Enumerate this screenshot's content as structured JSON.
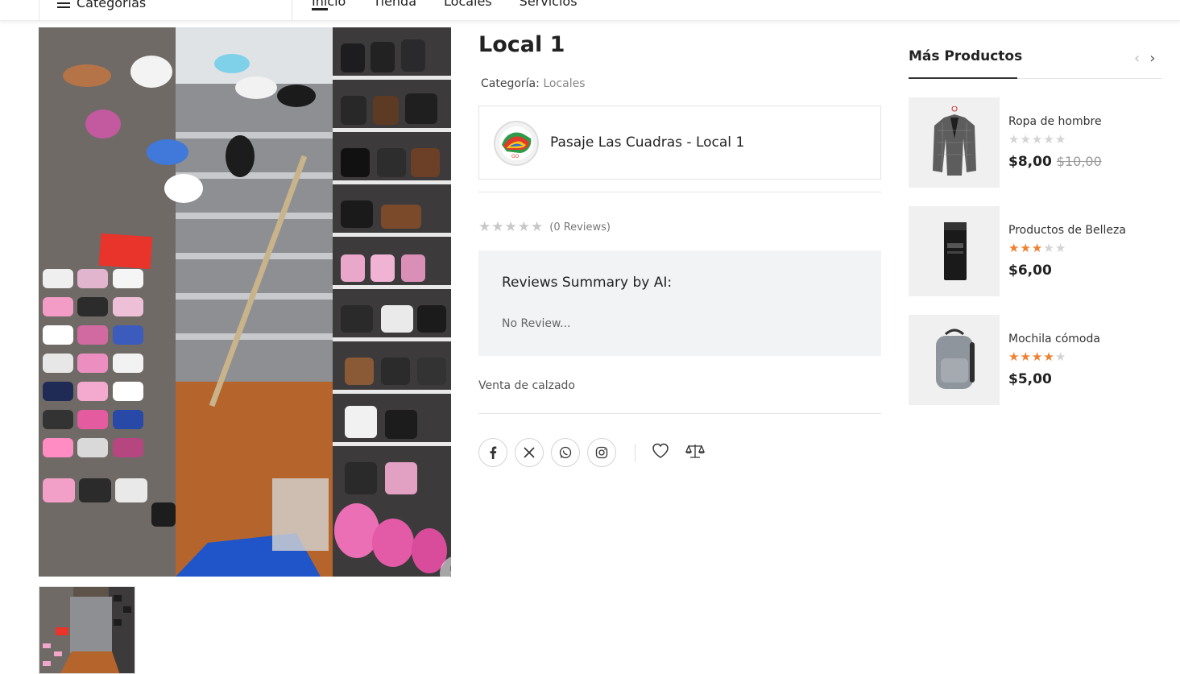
{
  "nav": {
    "categories_label": "Categorías",
    "links": [
      "Inicio",
      "Tienda",
      "Locales",
      "Servicios"
    ]
  },
  "product": {
    "title": "Local 1",
    "category_prefix": "Categoría:",
    "category_link": "Locales",
    "store_name": "Pasaje Las Cuadras - Local 1",
    "reviews_count_text": "(0 Reviews)",
    "rating": 0,
    "ai_summary_title": "Reviews Summary by AI:",
    "ai_summary_text": "No Review...",
    "description": "Venta de calzado"
  },
  "share": {
    "icons": [
      "facebook-icon",
      "x-icon",
      "whatsapp-icon",
      "instagram-icon"
    ],
    "actions": [
      "wishlist-heart-icon",
      "compare-scale-icon"
    ]
  },
  "sidebar": {
    "title": "Más Productos",
    "products": [
      {
        "name": "Ropa de hombre",
        "rating": 0,
        "price": "$8,00",
        "old_price": "$10,00"
      },
      {
        "name": "Productos de Belleza",
        "rating": 3,
        "price": "$6,00",
        "old_price": ""
      },
      {
        "name": "Mochila cómoda",
        "rating": 4,
        "price": "$5,00",
        "old_price": ""
      }
    ]
  },
  "colors": {
    "star_filled": "#f07f2e",
    "star_empty": "#d3d3d3",
    "ai_box_bg": "#f2f3f5"
  }
}
